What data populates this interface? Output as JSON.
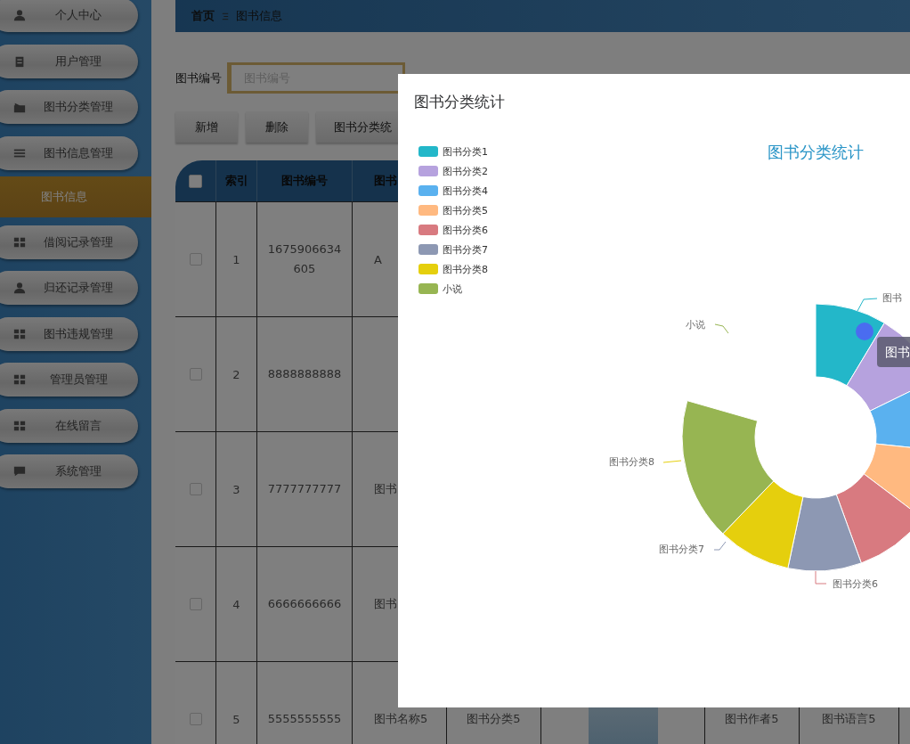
{
  "sidebar": {
    "items": [
      {
        "label": "个人中心",
        "kind": "menu",
        "selected": false
      },
      {
        "label": "用户管理",
        "kind": "menu",
        "selected": false
      },
      {
        "label": "图书分类管理",
        "kind": "menu",
        "selected": false
      },
      {
        "label": "图书信息管理",
        "kind": "menu",
        "selected": false
      },
      {
        "label": "图书信息",
        "kind": "submenu",
        "selected": true
      },
      {
        "label": "借阅记录管理",
        "kind": "menu",
        "selected": false
      },
      {
        "label": "归还记录管理",
        "kind": "menu",
        "selected": false
      },
      {
        "label": "图书违规管理",
        "kind": "menu",
        "selected": false
      },
      {
        "label": "管理员管理",
        "kind": "menu",
        "selected": false
      },
      {
        "label": "在线留言",
        "kind": "menu",
        "selected": false
      },
      {
        "label": "系统管理",
        "kind": "menu",
        "selected": false
      }
    ]
  },
  "breadcrumb": [
    "首页",
    "图书信息"
  ],
  "search": {
    "label": "图书编号",
    "placeholder": "图书编号"
  },
  "buttons": [
    "新增",
    "删除",
    "图书分类统"
  ],
  "table": {
    "select_all_checked": false,
    "columns": [
      "索引",
      "图书编号",
      "图书"
    ],
    "rows": [
      {
        "checked": false,
        "index": "1",
        "code": "1675906634605",
        "column_4": "A",
        "cover": false
      },
      {
        "checked": false,
        "index": "2",
        "code": "8888888888",
        "cover": false
      },
      {
        "checked": false,
        "index": "3",
        "code": "7777777777",
        "column_4": "图书",
        "cover": false
      },
      {
        "checked": false,
        "index": "4",
        "code": "6666666666",
        "column_4": "图书",
        "cover": false
      },
      {
        "checked": false,
        "index": "5",
        "code": "5555555555",
        "column_4": "图书名称5",
        "column_5": "图书分类5",
        "cover": true,
        "column_7": "图书作者5",
        "column_8": "图书语言5"
      }
    ]
  },
  "modal": {
    "title": "图书分类统计",
    "chart_title": "图书分类统计",
    "legend": [
      {
        "label": "图书分类1",
        "color": "#23b7c9"
      },
      {
        "label": "图书分类2",
        "color": "#b6a2de"
      },
      {
        "label": "图书分类4",
        "color": "#5ab1ef"
      },
      {
        "label": "图书分类5",
        "color": "#ffb980"
      },
      {
        "label": "图书分类6",
        "color": "#d87a80"
      },
      {
        "label": "图书分类7",
        "color": "#8d98b3"
      },
      {
        "label": "图书分类8",
        "color": "#e5cf0d"
      },
      {
        "label": "小说",
        "color": "#97b552"
      }
    ],
    "slice_labels": [
      "图书",
      "小说",
      "图书分类8",
      "图书分类7",
      "图书分类6"
    ],
    "tooltip": "图书"
  }
}
